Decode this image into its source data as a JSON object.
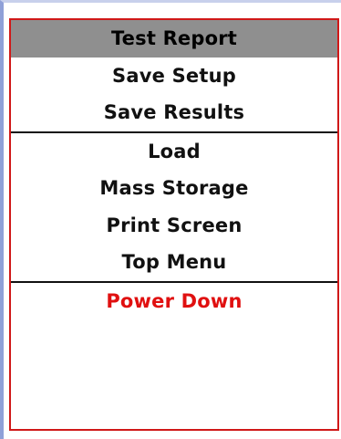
{
  "menu": {
    "items": [
      {
        "label": "Test Report"
      },
      {
        "label": "Save Setup"
      },
      {
        "label": "Save Results"
      },
      {
        "label": "Load"
      },
      {
        "label": "Mass Storage"
      },
      {
        "label": "Print Screen"
      },
      {
        "label": "Top Menu"
      },
      {
        "label": "Power Down"
      }
    ],
    "selected_item": "Test Report",
    "colors": {
      "border": "#d01818",
      "selected_background": "#8f8f8f",
      "danger_text": "#e01010",
      "divider": "#111111"
    }
  }
}
